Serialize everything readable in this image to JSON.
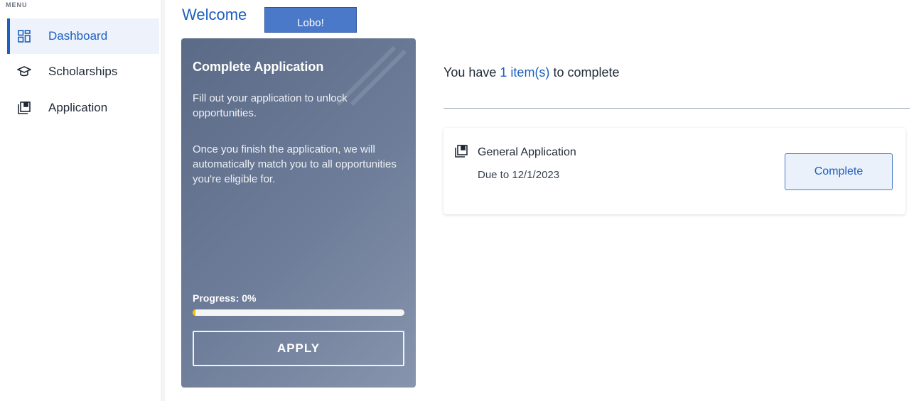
{
  "sidebar": {
    "menu_label": "MENU",
    "items": [
      {
        "label": "Dashboard",
        "icon": "dashboard-icon",
        "active": true
      },
      {
        "label": "Scholarships",
        "icon": "graduation-cap-icon",
        "active": false
      },
      {
        "label": "Application",
        "icon": "application-icon",
        "active": false
      }
    ]
  },
  "header": {
    "welcome": "Welcome",
    "user_name": "Lobo!"
  },
  "application_card": {
    "title": "Complete Application",
    "text1": "Fill out your application to unlock opportunities.",
    "text2": "Once you finish the application, we will automatically match you to all opportunities you're eligible for.",
    "progress_label": "Progress: 0%",
    "progress_value": 0,
    "apply_label": "APPLY"
  },
  "todo": {
    "prefix": "You have ",
    "count_text": "1 item(s)",
    "suffix": " to complete",
    "items": [
      {
        "title": "General Application",
        "due": "Due to 12/1/2023",
        "action_label": "Complete"
      }
    ]
  },
  "colors": {
    "accent": "#1d5fbf",
    "progress": "#f2c200"
  }
}
